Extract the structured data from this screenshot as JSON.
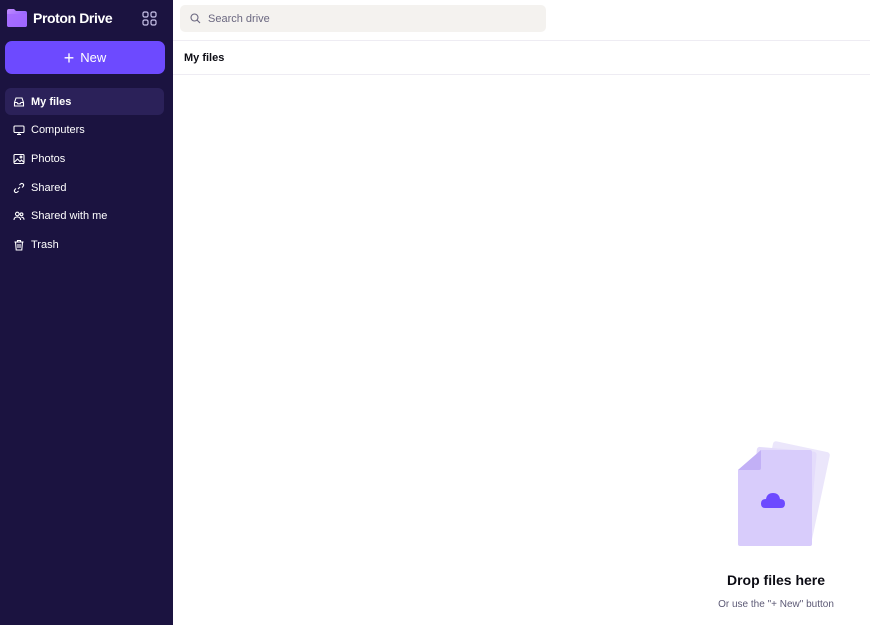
{
  "app": {
    "name": "Proton Drive"
  },
  "sidebar": {
    "new_label": "New",
    "items": [
      {
        "label": "My files",
        "icon": "drive-icon",
        "active": true
      },
      {
        "label": "Computers",
        "icon": "monitor-icon",
        "active": false
      },
      {
        "label": "Photos",
        "icon": "image-icon",
        "active": false
      },
      {
        "label": "Shared",
        "icon": "link-icon",
        "active": false
      },
      {
        "label": "Shared with me",
        "icon": "users-icon",
        "active": false
      },
      {
        "label": "Trash",
        "icon": "trash-icon",
        "active": false
      }
    ]
  },
  "search": {
    "placeholder": "Search drive",
    "value": ""
  },
  "main": {
    "title": "My files",
    "empty_title": "Drop files here",
    "empty_subtitle": "Or use the \"+ New\" button"
  },
  "colors": {
    "sidebar_bg": "#1b1340",
    "accent": "#6d4aff",
    "active_item": "#2b2159"
  }
}
